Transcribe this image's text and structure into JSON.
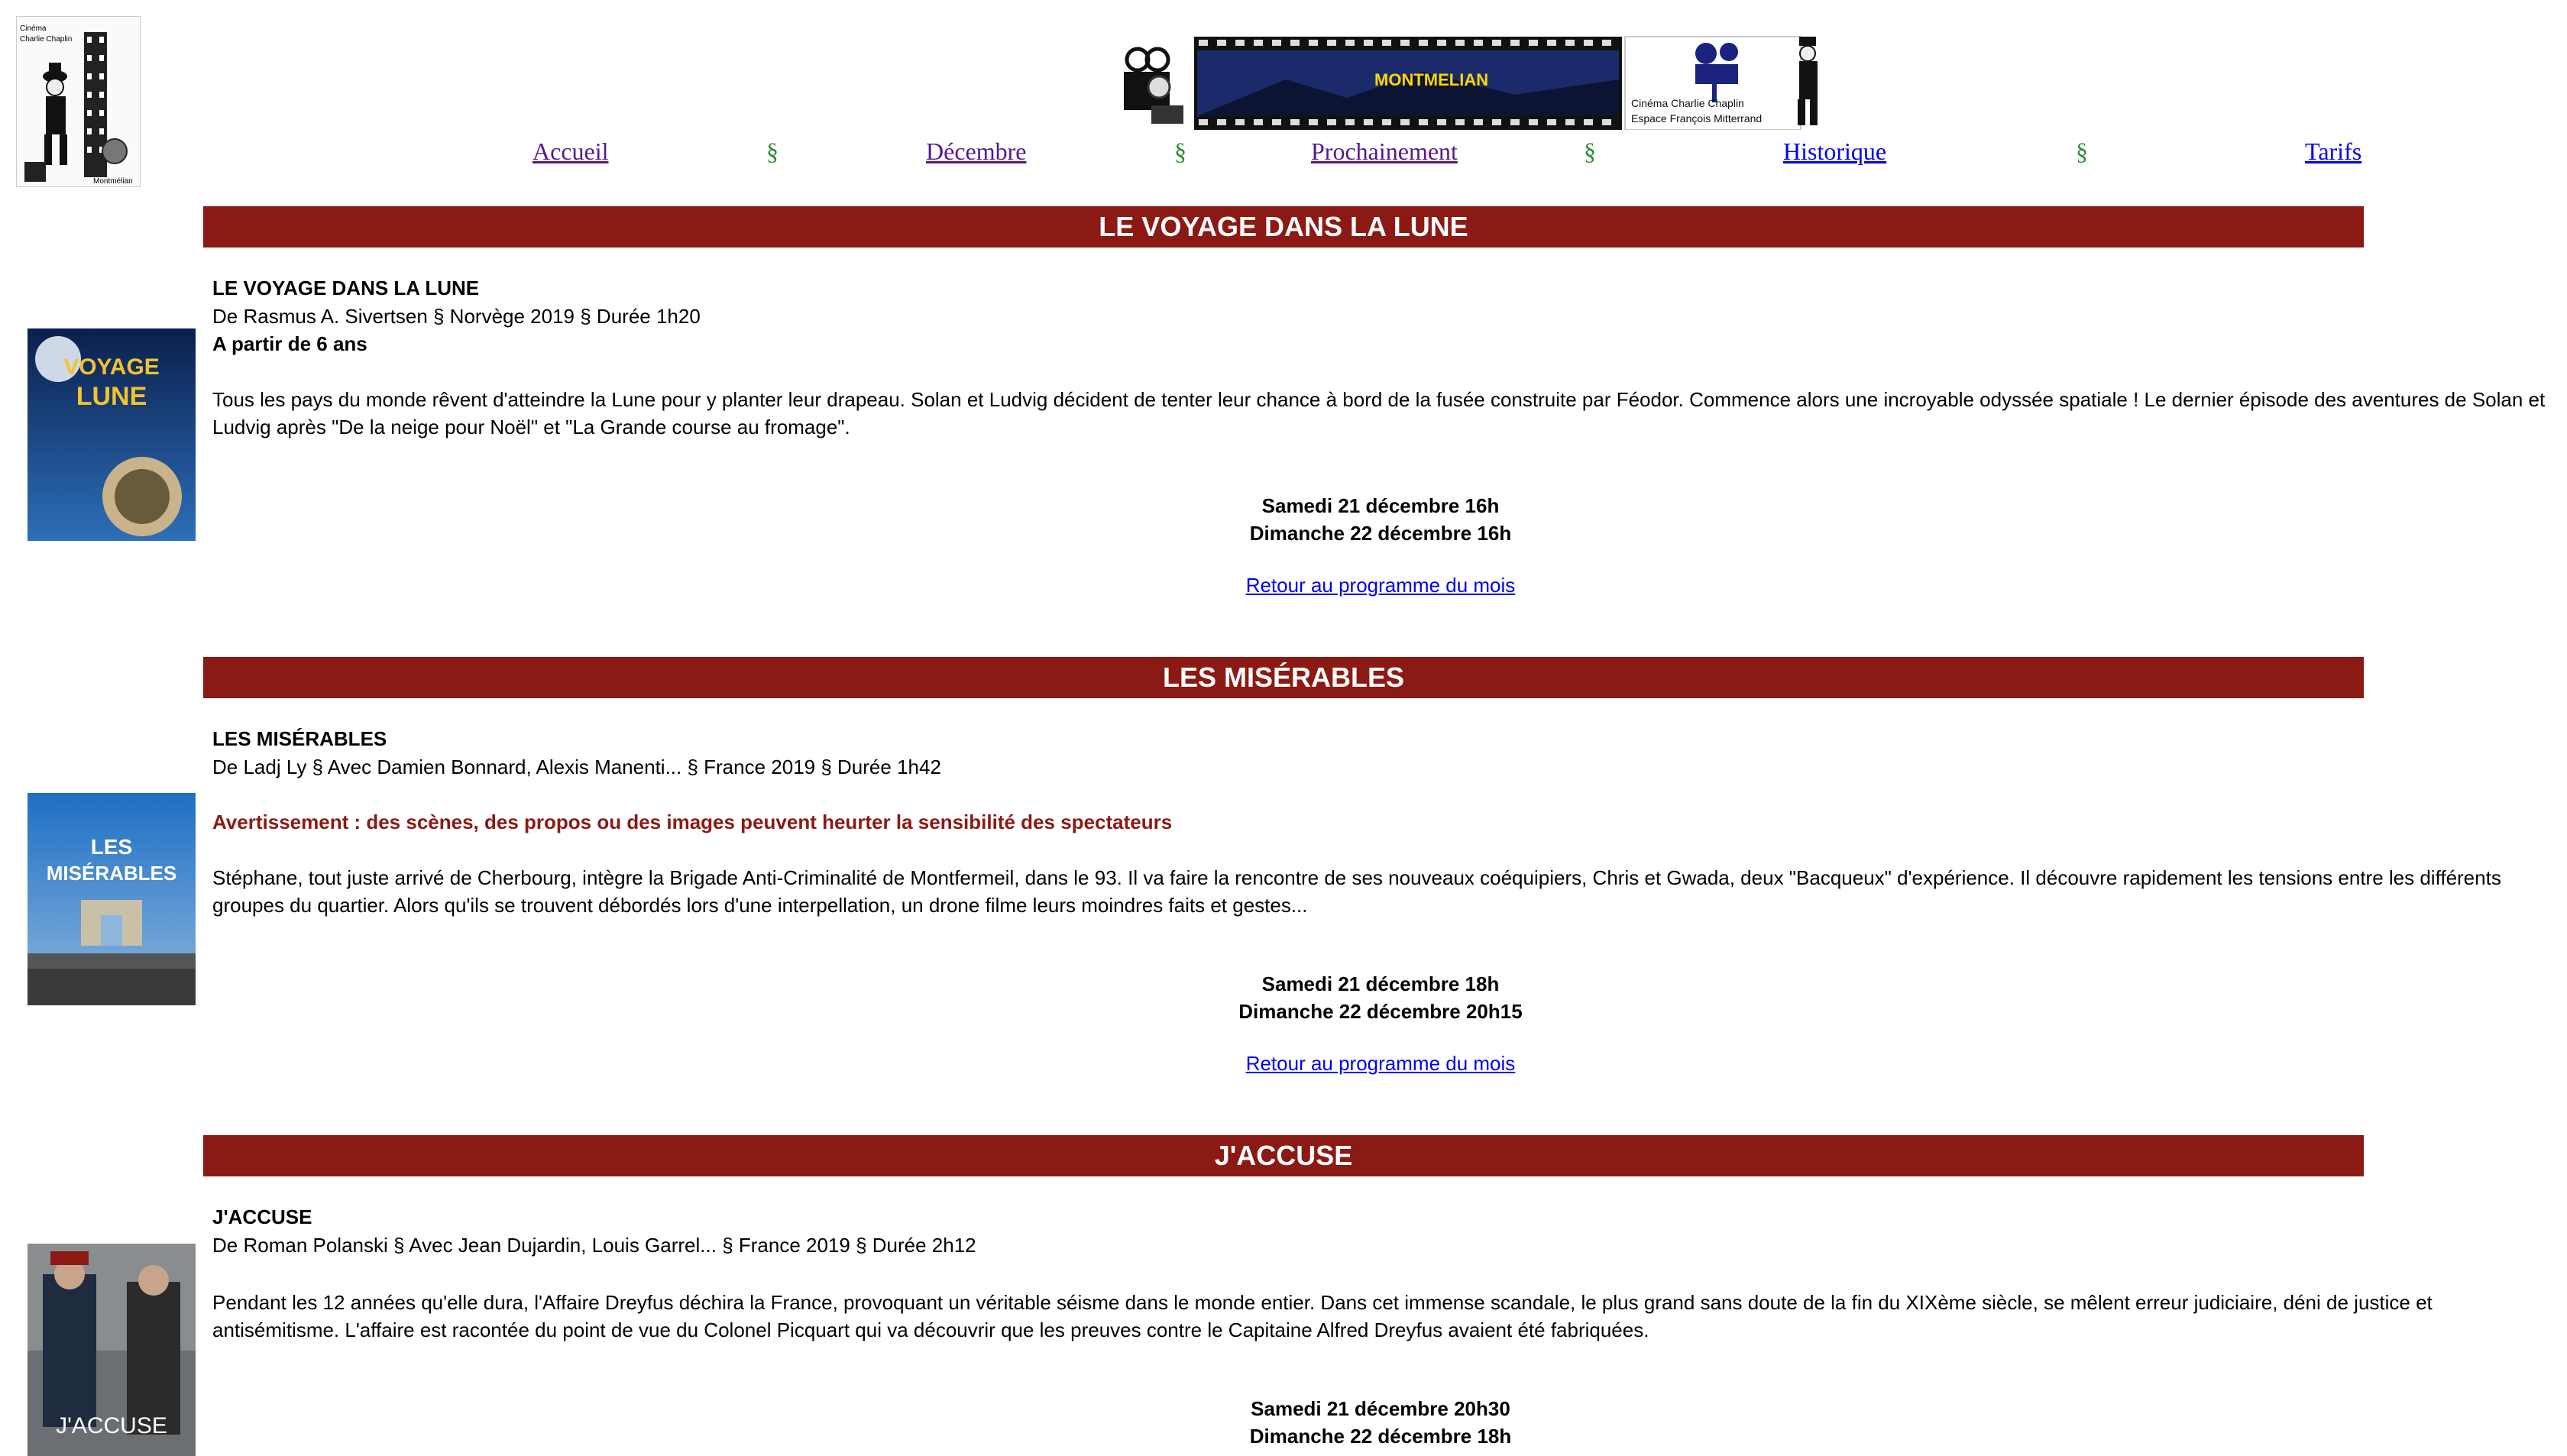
{
  "header": {
    "logo_lines": [
      "Cinéma",
      "Charlie Chaplin",
      "Montmélian"
    ],
    "banner_title": "MONTMELIAN",
    "banner_subtitle_1": "Cinéma Charlie Chaplin",
    "banner_subtitle_2": "Espace François Mitterrand"
  },
  "nav": {
    "items": [
      "Accueil",
      "Décembre",
      "Prochainement",
      "Historique",
      "Tarifs"
    ],
    "separator": "§"
  },
  "films": [
    {
      "banner": "LE VOYAGE DANS LA LUNE",
      "title": "LE VOYAGE DANS LA LUNE",
      "credits": "De Rasmus A. Sivertsen § Norvège 2019 § Durée 1h20",
      "note": "A partir de 6 ans",
      "synopsis_1": "Tous les pays du monde rêvent d'atteindre la Lune pour y planter leur drapeau. Solan et Ludvig décident de tenter leur chance à bord de la fusée construite par Féodor. Commence alors une incroyable odyssée spatiale ! Le dernier épisode des aventures de Solan et",
      "synopsis_2": "Ludvig après \"De la neige pour Noël\" et \"La Grande course au fromage\".",
      "show_1": "Samedi 21 décembre 16h",
      "show_2": "Dimanche 22 décembre 16h",
      "back": "Retour au programme du mois",
      "poster_text": "LE VOYAGE DANS LA LUNE"
    },
    {
      "banner": "LES MISÉRABLES",
      "title": "LES MISÉRABLES",
      "credits": "De Ladj Ly § Avec Damien Bonnard, Alexis Manenti... § France 2019 § Durée 1h42",
      "warning": "Avertissement : des scènes, des propos ou des images peuvent heurter la sensibilité des spectateurs",
      "synopsis_1": "Stéphane, tout juste arrivé de Cherbourg, intègre la Brigade Anti-Criminalité de Montfermeil, dans le 93. Il va faire la rencontre de ses nouveaux coéquipiers, Chris et Gwada, deux \"Bacqueux\" d'expérience. Il découvre rapidement les tensions entre les différents",
      "synopsis_2": "groupes du quartier. Alors qu'ils se trouvent débordés lors d'une interpellation, un drone filme leurs moindres faits et gestes...",
      "show_1": "Samedi 21 décembre 18h",
      "show_2": "Dimanche 22 décembre 20h15",
      "back": "Retour au programme du mois",
      "poster_text": "LES MISÉRABLES"
    },
    {
      "banner": "J'ACCUSE",
      "title": "J'ACCUSE",
      "credits": "De Roman Polanski § Avec Jean Dujardin, Louis Garrel... § France 2019 § Durée 2h12",
      "synopsis_1": "Pendant les 12 années qu'elle dura, l'Affaire Dreyfus déchira la France, provoquant un véritable séisme dans le monde entier. Dans cet immense scandale, le plus grand sans doute de la fin du XIXème siècle, se mêlent erreur judiciaire, déni de justice et",
      "synopsis_2": "antisémitisme. L'affaire est racontée du point de vue du Colonel Picquart qui va découvrir que les preuves contre le Capitaine Alfred Dreyfus avaient été fabriquées.",
      "show_1": "Samedi 21 décembre 20h30",
      "show_2": "Dimanche 22 décembre 18h",
      "poster_text": "J'ACCUSE"
    }
  ]
}
